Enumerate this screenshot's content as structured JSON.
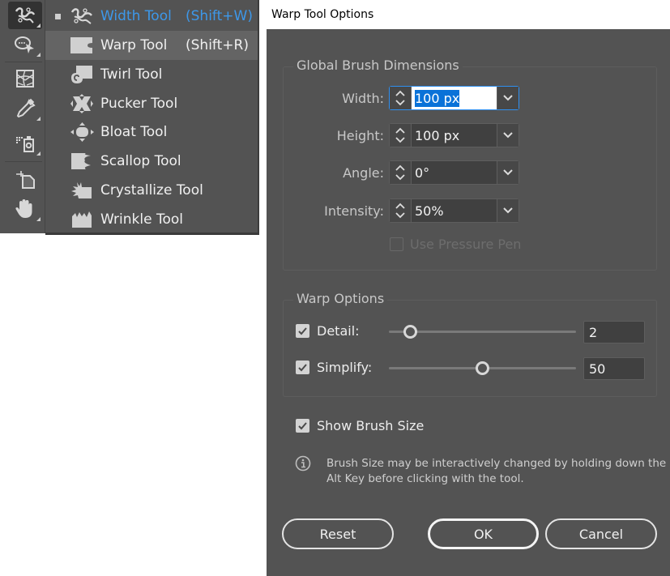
{
  "toolbar": {
    "tools": [
      {
        "name": "width-tool",
        "icon": "width-tool-icon",
        "active": true,
        "has_flyout": true
      },
      {
        "name": "shape-builder-tool",
        "icon": "shape-builder-icon",
        "active": false,
        "has_flyout": true
      },
      {
        "name": "perspective-grid-tool",
        "icon": "perspective-grid-icon",
        "active": false,
        "has_flyout": false
      },
      {
        "name": "eyedropper-tool",
        "icon": "eyedropper-icon",
        "active": false,
        "has_flyout": true
      },
      {
        "name": "symbol-sprayer-tool",
        "icon": "symbol-sprayer-icon",
        "active": false,
        "has_flyout": true
      },
      {
        "name": "artboard-tool",
        "icon": "artboard-icon",
        "active": false,
        "has_flyout": false
      },
      {
        "name": "hand-tool",
        "icon": "hand-icon",
        "active": false,
        "has_flyout": true
      }
    ]
  },
  "flyout": {
    "items": [
      {
        "label": "Width Tool",
        "shortcut": "(Shift+W)",
        "icon": "width-tool-icon",
        "selected": true
      },
      {
        "label": "Warp Tool",
        "shortcut": "(Shift+R)",
        "icon": "warp-tool-icon",
        "hover": true
      },
      {
        "label": "Twirl Tool",
        "shortcut": "",
        "icon": "twirl-tool-icon"
      },
      {
        "label": "Pucker Tool",
        "shortcut": "",
        "icon": "pucker-tool-icon"
      },
      {
        "label": "Bloat Tool",
        "shortcut": "",
        "icon": "bloat-tool-icon"
      },
      {
        "label": "Scallop Tool",
        "shortcut": "",
        "icon": "scallop-tool-icon"
      },
      {
        "label": "Crystallize Tool",
        "shortcut": "",
        "icon": "crystallize-tool-icon"
      },
      {
        "label": "Wrinkle Tool",
        "shortcut": "",
        "icon": "wrinkle-tool-icon"
      }
    ]
  },
  "dialog": {
    "title": "Warp Tool Options",
    "brush_group": {
      "title": "Global Brush Dimensions",
      "fields": [
        {
          "label": "Width:",
          "value": "100 px",
          "focused": true
        },
        {
          "label": "Height:",
          "value": "100 px"
        },
        {
          "label": "Angle:",
          "value": "0°"
        },
        {
          "label": "Intensity:",
          "value": "50%"
        }
      ],
      "pressure_pen": {
        "label": "Use Pressure Pen",
        "checked": false,
        "disabled": true
      }
    },
    "warp_group": {
      "title": "Warp Options",
      "detail": {
        "label": "Detail:",
        "checked": true,
        "value": "2",
        "min": 1,
        "max": 10
      },
      "simplify": {
        "label": "Simplify:",
        "checked": true,
        "value": "50",
        "min": 0.2,
        "max": 100
      }
    },
    "show_brush_size": {
      "label": "Show Brush Size",
      "checked": true
    },
    "info": {
      "icon": "info-icon",
      "text": "Brush Size may be interactively changed by holding down the Alt Key before clicking with the tool."
    },
    "buttons": {
      "reset": "Reset",
      "ok": "OK",
      "cancel": "Cancel"
    }
  }
}
